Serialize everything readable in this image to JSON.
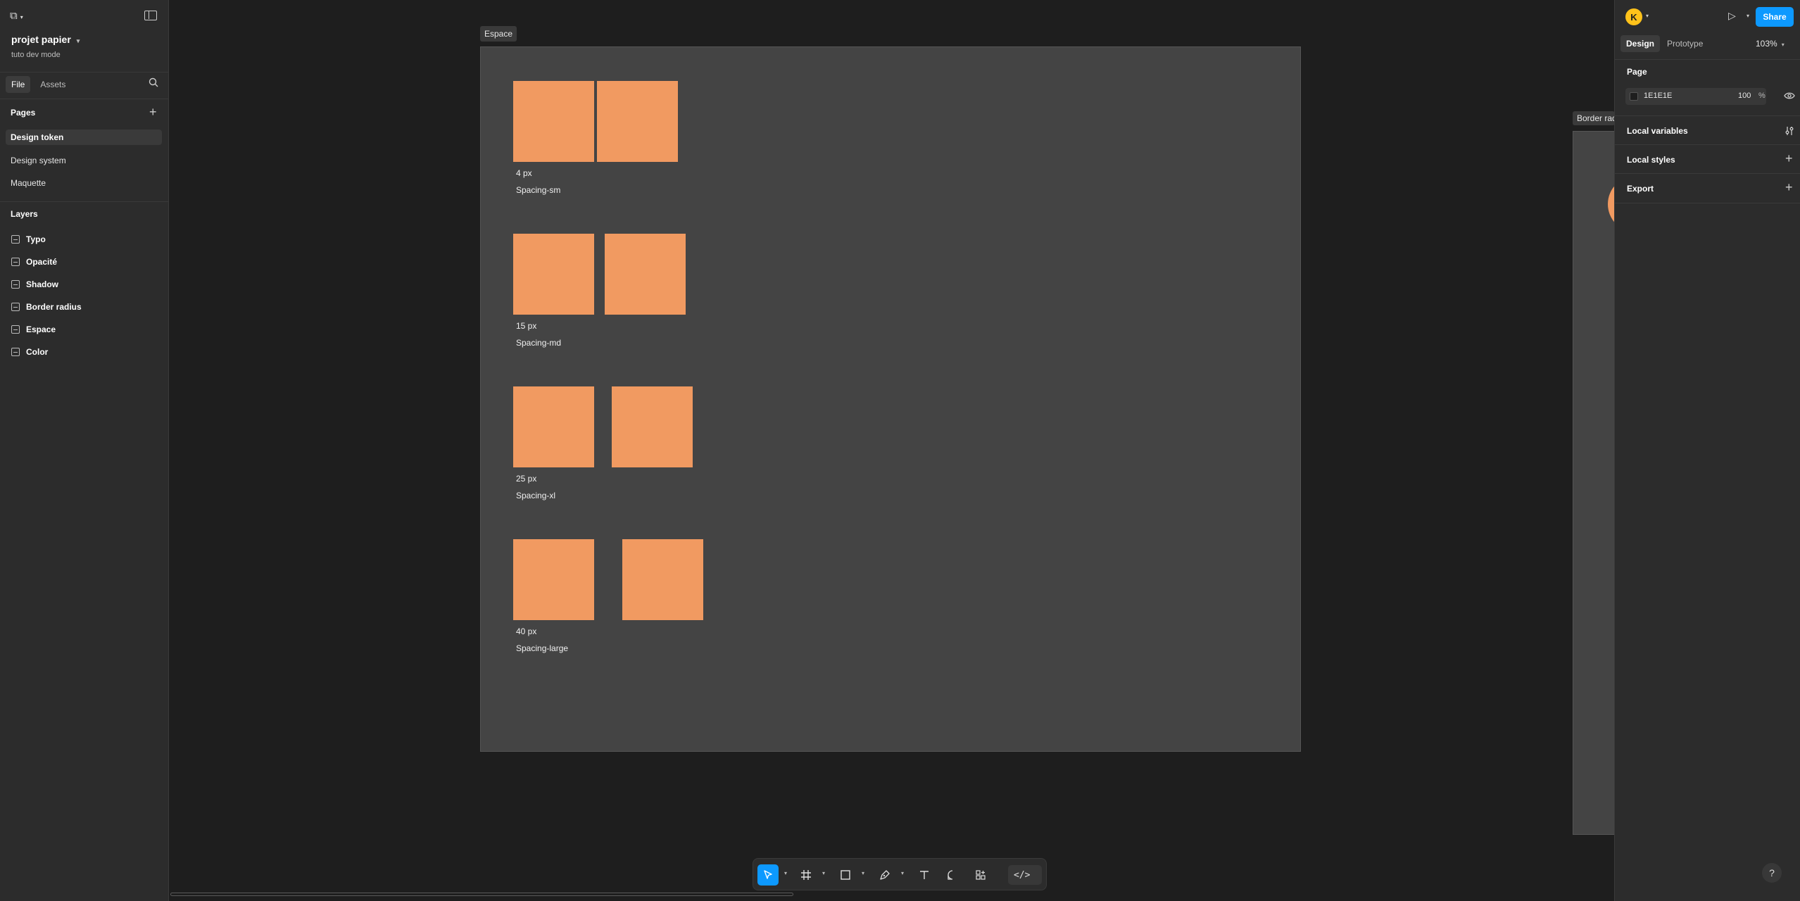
{
  "left_panel": {
    "project_title": "projet papier",
    "project_subtitle": "tuto dev mode",
    "tabs": [
      {
        "label": "File"
      },
      {
        "label": "Assets"
      }
    ],
    "pages_heading": "Pages",
    "pages": [
      {
        "label": "Design token"
      },
      {
        "label": "Design system"
      },
      {
        "label": "Maquette"
      }
    ],
    "layers_heading": "Layers",
    "layers": [
      {
        "label": "Typo"
      },
      {
        "label": "Opacité"
      },
      {
        "label": "Shadow"
      },
      {
        "label": "Border radius"
      },
      {
        "label": "Espace"
      },
      {
        "label": "Color"
      }
    ]
  },
  "canvas": {
    "frame_label": "Espace",
    "border_frame_label": "Border radius",
    "spacing_groups": [
      {
        "value": "4 px",
        "name": "Spacing-sm"
      },
      {
        "value": "15 px",
        "name": "Spacing-md"
      },
      {
        "value": "25 px",
        "name": "Spacing-xl"
      },
      {
        "value": "40 px",
        "name": "Spacing-large"
      }
    ],
    "square_color": "#f19a61",
    "frame_color": "#444444"
  },
  "toolbar": {
    "tools": [
      "move-tool",
      "frame-tool",
      "shape-tool",
      "pen-tool",
      "text-tool",
      "comment-tool",
      "actions-tool",
      "dev-mode-toggle"
    ],
    "code_label": "</>"
  },
  "right_panel": {
    "avatar_initial": "K",
    "share_label": "Share",
    "tabs": [
      {
        "label": "Design"
      },
      {
        "label": "Prototype"
      }
    ],
    "zoom": "103%",
    "page_heading": "Page",
    "page_color_hex": "1E1E1E",
    "page_opacity": "100",
    "percent_sign": "%",
    "local_variables": "Local variables",
    "local_styles": "Local styles",
    "export": "Export"
  },
  "help_label": "?"
}
